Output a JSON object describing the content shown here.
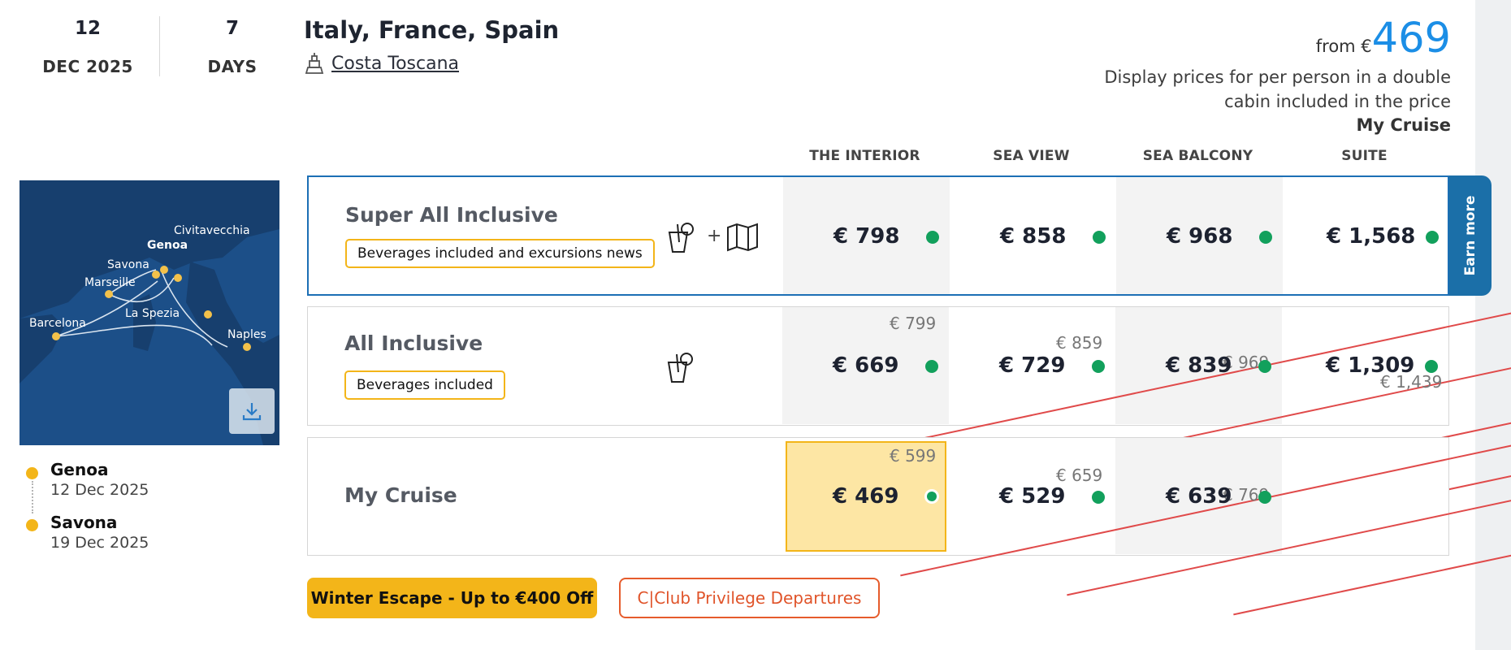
{
  "header": {
    "day": "12",
    "month_year": "DEC 2025",
    "duration": "7",
    "duration_unit": "DAYS",
    "title": "Italy, France, Spain",
    "ship": "Costa Toscana",
    "from_label": "from €",
    "from_price": "469",
    "price_note": "Display prices for per person in a double cabin included in the price",
    "price_note_package": "My Cruise"
  },
  "columns": [
    "THE INTERIOR",
    "SEA VIEW",
    "SEA BALCONY",
    "SUITE"
  ],
  "map": {
    "labels": [
      "Civitavecchia",
      "Genoa",
      "Savona",
      "Marseille",
      "La Spezia",
      "Barcelona",
      "Naples"
    ]
  },
  "itinerary": [
    {
      "port": "Genoa",
      "date": "12 Dec 2025"
    },
    {
      "port": "Savona",
      "date": "19 Dec 2025"
    }
  ],
  "packages": [
    {
      "name": "Super All Inclusive",
      "tag": "Beverages included and excursions news",
      "icons": [
        "drink-icon",
        "map-icon"
      ],
      "prices": [
        {
          "old": "",
          "price": "€ 798"
        },
        {
          "old": "",
          "price": "€ 858"
        },
        {
          "old": "",
          "price": "€ 968"
        },
        {
          "old": "",
          "price": "€ 1,568"
        }
      ]
    },
    {
      "name": "All Inclusive",
      "tag": "Beverages included",
      "icons": [
        "drink-icon"
      ],
      "prices": [
        {
          "old": "€ 799",
          "price": "€ 669"
        },
        {
          "old": "€ 859",
          "price": "€ 729"
        },
        {
          "old": "€ 969",
          "price": "€ 839"
        },
        {
          "old": "€ 1,439",
          "price": "€ 1,309"
        }
      ]
    },
    {
      "name": "My Cruise",
      "tag": "",
      "icons": [],
      "prices": [
        {
          "old": "€ 599",
          "price": "€ 469"
        },
        {
          "old": "€ 659",
          "price": "€ 529"
        },
        {
          "old": "€ 769",
          "price": "€ 639"
        },
        {
          "old": "",
          "price": ""
        }
      ]
    }
  ],
  "earn_more": "Earn more",
  "buttons": {
    "promo": "Winter Escape - Up to €400 Off",
    "club": "C|Club Privilege Departures"
  },
  "colors": {
    "accent_blue": "#1b8ee6",
    "selected_border": "#1c6fb5",
    "yellow": "#f3b519",
    "green": "#12a05c",
    "club_orange": "#e65c2c"
  }
}
